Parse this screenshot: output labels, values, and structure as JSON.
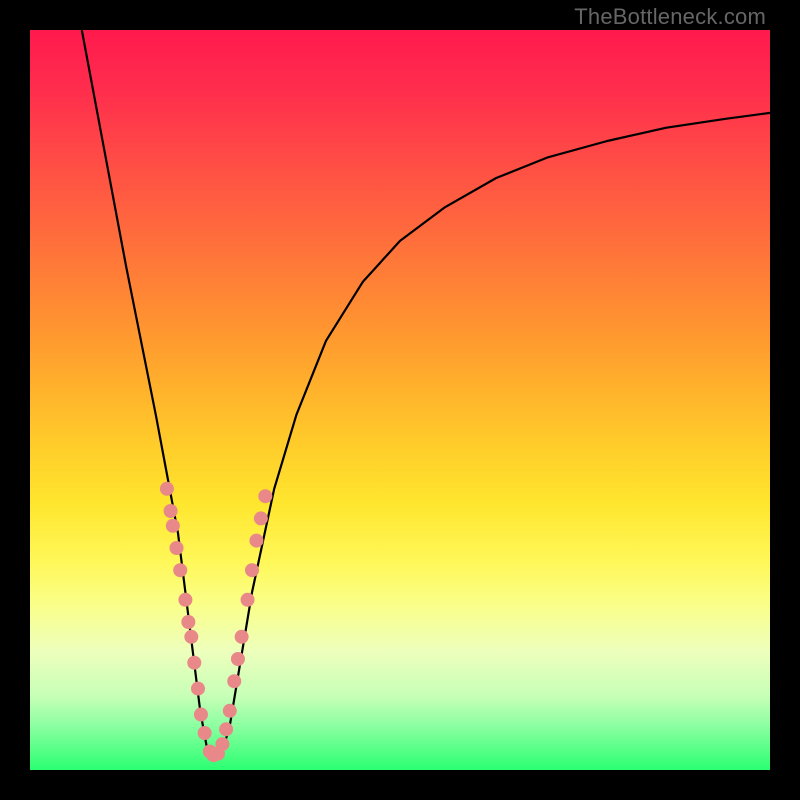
{
  "watermark": "TheBottleneck.com",
  "colors": {
    "frame": "#000000",
    "curve": "#000000",
    "dot": "#e88888",
    "gradient_top": "#ff1a4d",
    "gradient_bottom": "#2bff71"
  },
  "chart_data": {
    "type": "line",
    "title": "",
    "xlabel": "",
    "ylabel": "",
    "xlim": [
      0,
      100
    ],
    "ylim": [
      0,
      100
    ],
    "note": "No axis ticks or labels are shown. x/y are percentages of the plot area (0,0 at bottom-left). Curve drawn from top-left down to a minimum near x≈25 then rising toward upper right; dots appear in the lower region of the V.",
    "series": [
      {
        "name": "curve",
        "x": [
          7.0,
          10.0,
          13.0,
          15.0,
          17.0,
          18.5,
          20.0,
          21.0,
          22.0,
          23.0,
          24.0,
          25.0,
          26.0,
          27.0,
          28.0,
          30.0,
          33.0,
          36.0,
          40.0,
          45.0,
          50.0,
          56.0,
          63.0,
          70.0,
          78.0,
          86.0,
          94.0,
          100.0
        ],
        "y": [
          100.0,
          84.0,
          68.0,
          58.0,
          48.0,
          40.0,
          32.0,
          24.0,
          16.0,
          8.0,
          2.5,
          1.5,
          2.5,
          6.0,
          12.0,
          24.0,
          38.0,
          48.0,
          58.0,
          66.0,
          71.5,
          76.0,
          80.0,
          82.8,
          85.0,
          86.8,
          88.0,
          88.8
        ]
      },
      {
        "name": "dots",
        "x": [
          18.5,
          19.0,
          19.3,
          19.8,
          20.3,
          21.0,
          21.4,
          21.8,
          22.2,
          22.7,
          23.1,
          23.6,
          24.3,
          24.8,
          25.4,
          26.0,
          26.5,
          27.0,
          27.6,
          28.1,
          28.6,
          29.4,
          30.0,
          30.6,
          31.2,
          31.8
        ],
        "y": [
          38.0,
          35.0,
          33.0,
          30.0,
          27.0,
          23.0,
          20.0,
          18.0,
          14.5,
          11.0,
          7.5,
          5.0,
          2.5,
          2.0,
          2.2,
          3.5,
          5.5,
          8.0,
          12.0,
          15.0,
          18.0,
          23.0,
          27.0,
          31.0,
          34.0,
          37.0
        ]
      }
    ]
  }
}
